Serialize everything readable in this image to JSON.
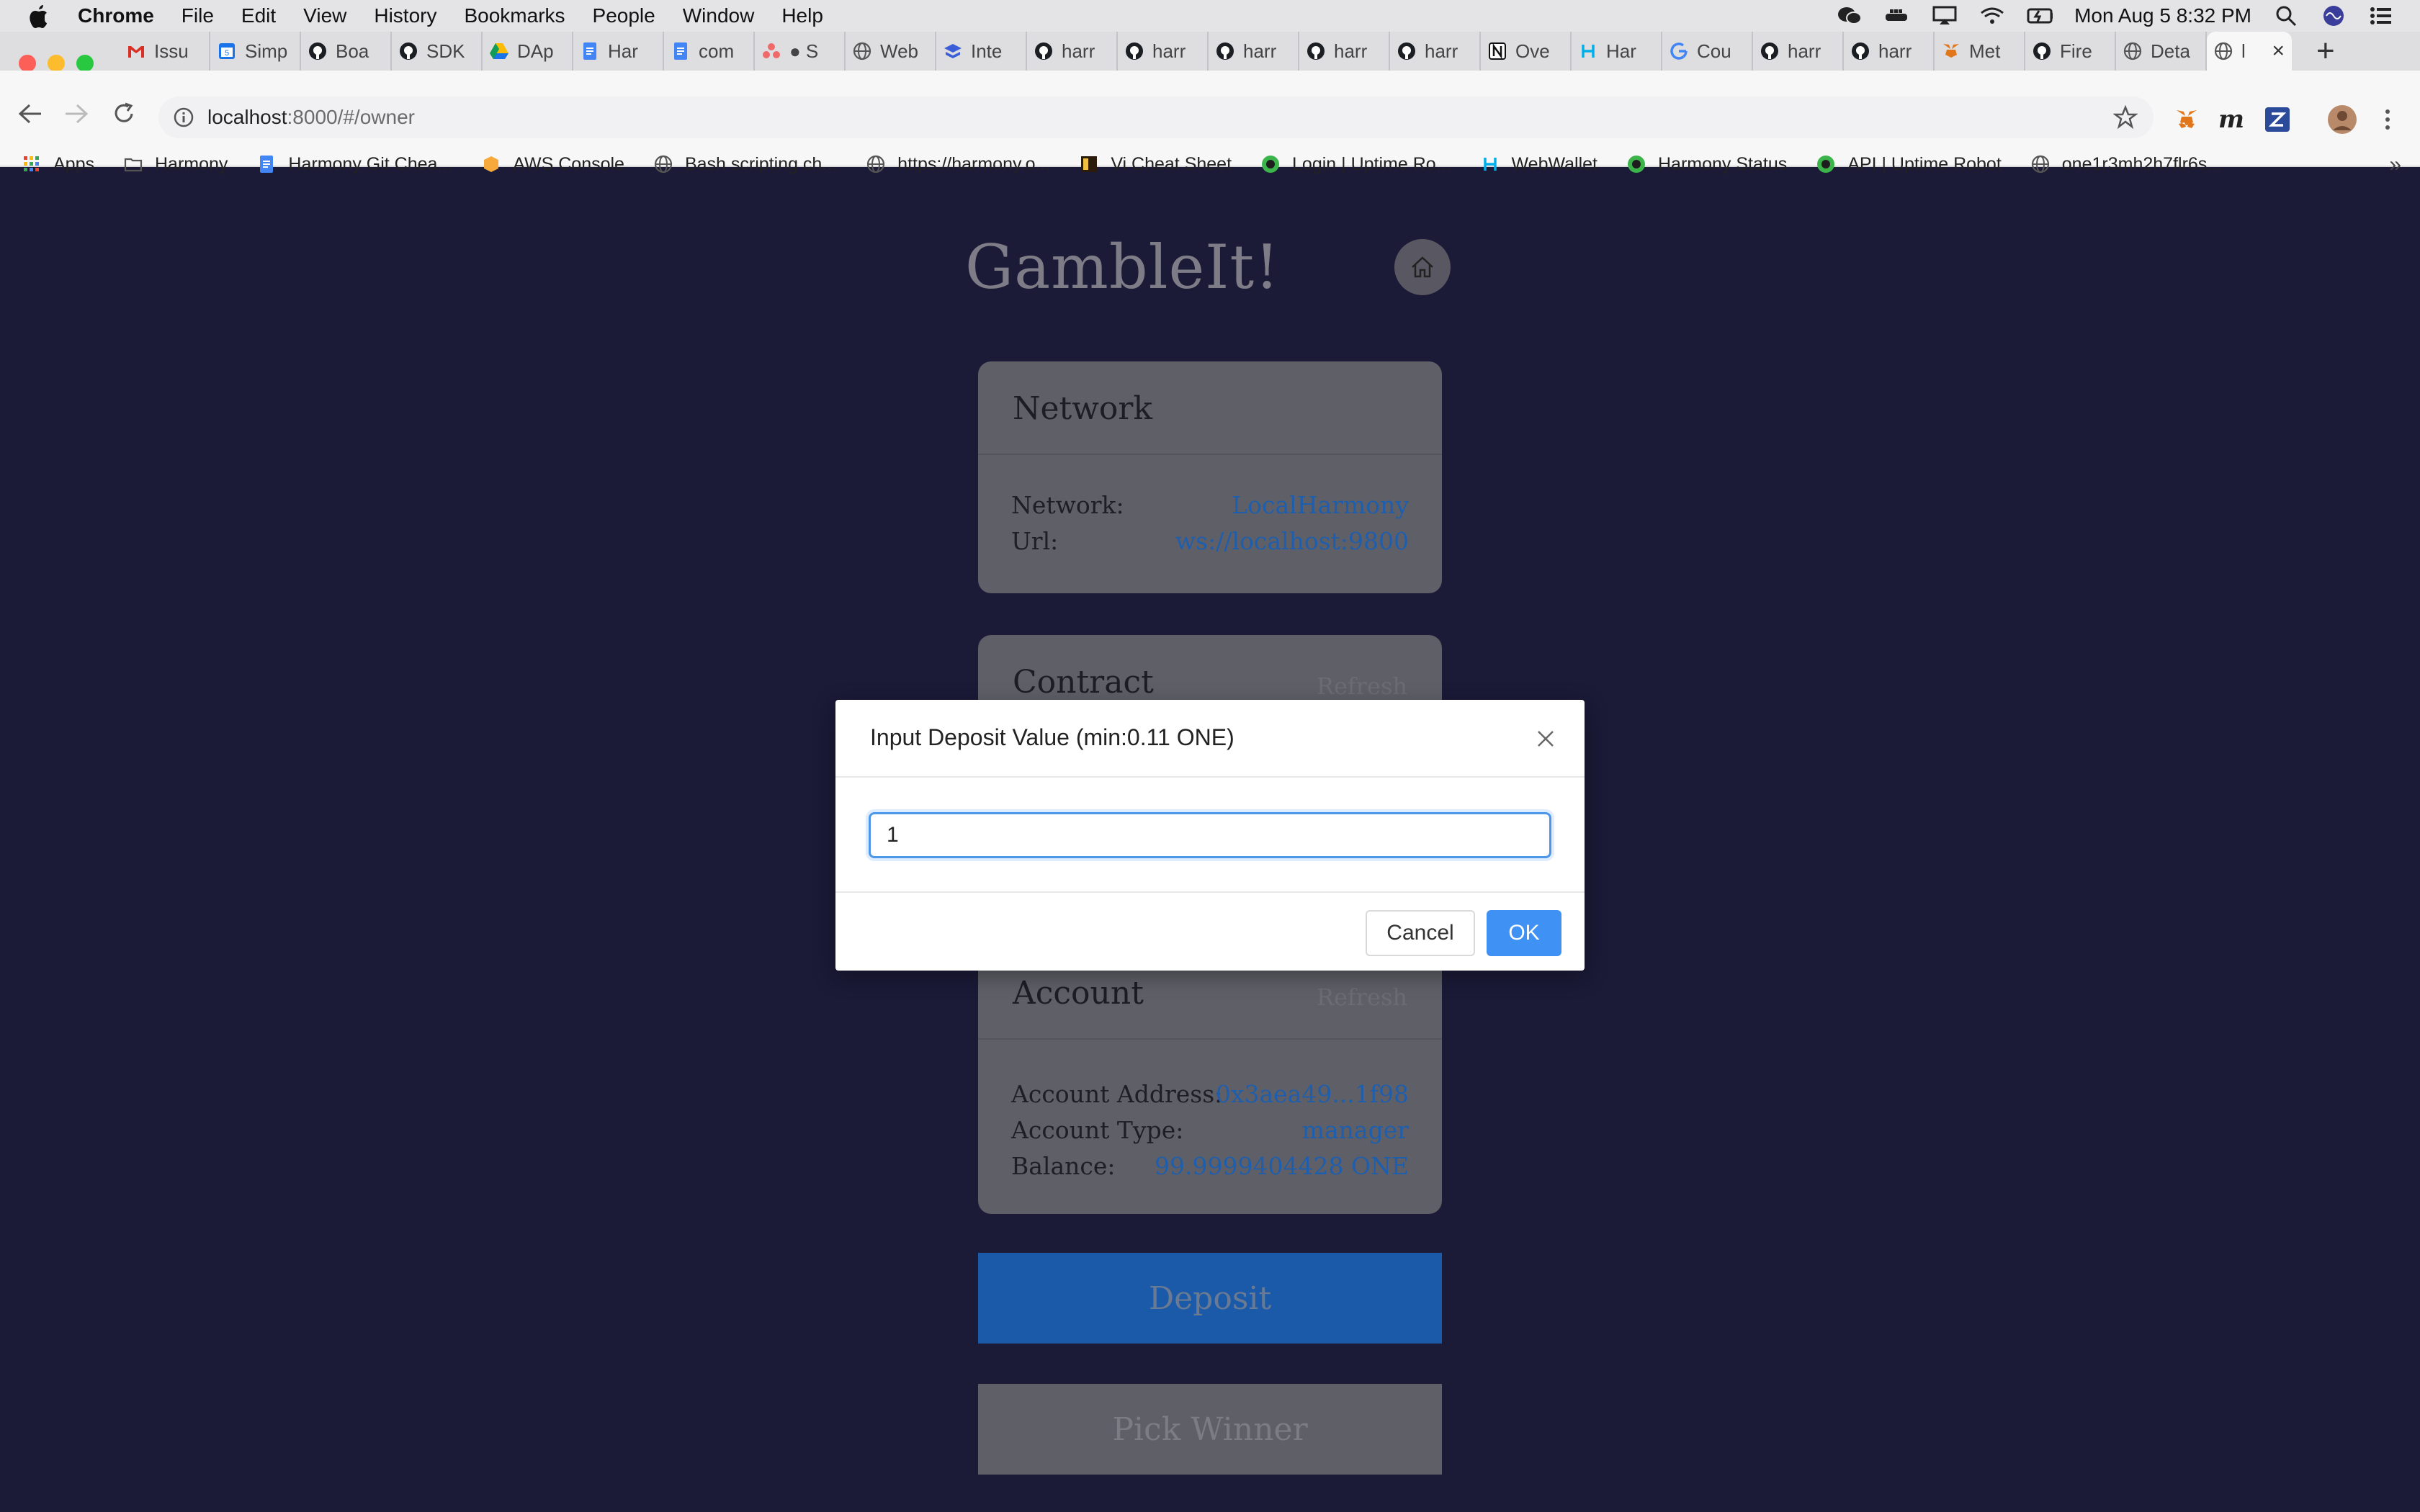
{
  "os_menubar": {
    "app_name": "Chrome",
    "menus": [
      "File",
      "Edit",
      "View",
      "History",
      "Bookmarks",
      "People",
      "Window",
      "Help"
    ],
    "clock": "Mon Aug 5  8:32 PM"
  },
  "browser": {
    "tabs": [
      {
        "label": "Issu",
        "icon": "gmail-icon"
      },
      {
        "label": "Simp",
        "icon": "calendar-icon"
      },
      {
        "label": "Boa",
        "icon": "github-icon"
      },
      {
        "label": "SDK",
        "icon": "github-icon"
      },
      {
        "label": "DAp",
        "icon": "drive-icon"
      },
      {
        "label": "Har",
        "icon": "docs-icon"
      },
      {
        "label": "com",
        "icon": "docs-icon"
      },
      {
        "label": "● S",
        "icon": "asana-icon"
      },
      {
        "label": "Web",
        "icon": "globe-icon"
      },
      {
        "label": "Inte",
        "icon": "stack-icon"
      },
      {
        "label": "harr",
        "icon": "github-icon"
      },
      {
        "label": "harr",
        "icon": "github-icon"
      },
      {
        "label": "harr",
        "icon": "github-icon"
      },
      {
        "label": "harr",
        "icon": "github-icon"
      },
      {
        "label": "harr",
        "icon": "github-icon"
      },
      {
        "label": "Ove",
        "icon": "notion-icon"
      },
      {
        "label": "Har",
        "icon": "harmony-icon"
      },
      {
        "label": "Cou",
        "icon": "google-icon"
      },
      {
        "label": "harr",
        "icon": "github-icon"
      },
      {
        "label": "harr",
        "icon": "github-icon"
      },
      {
        "label": "Met",
        "icon": "metamask-icon"
      },
      {
        "label": "Fire",
        "icon": "github-icon"
      },
      {
        "label": "Deta",
        "icon": "globe-icon"
      },
      {
        "label": "l",
        "icon": "globe-icon",
        "active": true
      }
    ],
    "address_host": "localhost",
    "address_path": ":8000/#/owner",
    "bookmarks": [
      {
        "label": "Apps",
        "icon": "apps-grid-icon"
      },
      {
        "label": "Harmony",
        "icon": "folder-icon"
      },
      {
        "label": "Harmony Git Chea...",
        "icon": "docs-icon"
      },
      {
        "label": "AWS Console",
        "icon": "aws-icon"
      },
      {
        "label": "Bash scripting ch...",
        "icon": "globe-icon"
      },
      {
        "label": "https://harmony.o...",
        "icon": "globe-icon"
      },
      {
        "label": "Vi Cheat Sheet",
        "icon": "vi-icon"
      },
      {
        "label": "Login | Uptime Ro...",
        "icon": "uptime-icon"
      },
      {
        "label": "WebWallet",
        "icon": "harmony-icon"
      },
      {
        "label": "Harmony Status",
        "icon": "uptime-icon"
      },
      {
        "label": "API | Uptime Robot",
        "icon": "uptime-icon"
      },
      {
        "label": "one1r3mh2h7flr6s...",
        "icon": "globe-icon"
      }
    ]
  },
  "app": {
    "title": "GambleIt!",
    "network_card": {
      "title": "Network",
      "rows": [
        {
          "key": "Network:",
          "value": "LocalHarmony"
        },
        {
          "key": "Url:",
          "value": "ws://localhost:9800"
        }
      ]
    },
    "contract_card": {
      "title": "Contract",
      "refresh": "Refresh"
    },
    "account_card": {
      "title": "Account",
      "refresh": "Refresh",
      "rows": [
        {
          "key": "Account Address:",
          "value": "0x3aea49...1f98"
        },
        {
          "key": "Account Type:",
          "value": "manager"
        },
        {
          "key": "Balance:",
          "value": "99.9999404428 ONE"
        }
      ]
    },
    "deposit_button": "Deposit",
    "pick_winner_button": "Pick Winner"
  },
  "modal": {
    "title": "Input Deposit Value (min:0.11 ONE)",
    "input_value": "1",
    "cancel_label": "Cancel",
    "ok_label": "OK"
  },
  "colors": {
    "page_bg": "#1b1a37",
    "link_blue": "#1d5fae",
    "primary": "#3f92f3"
  }
}
